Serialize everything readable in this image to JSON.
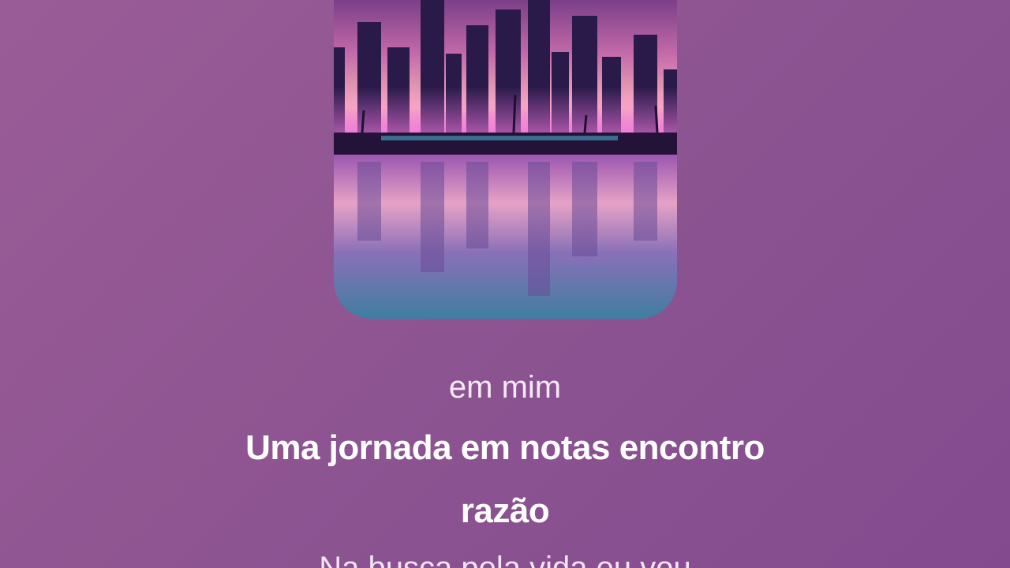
{
  "player": {
    "cover_icon": "city-skyline-artwork",
    "lyrics": {
      "previous": "em mim",
      "current_line_1": "Uma jornada em notas encontro",
      "current_line_2": "razão",
      "next_partial": "Na busca pela vida eu vou"
    }
  },
  "colors": {
    "background": "#8e5592",
    "text": "#ffffff"
  }
}
